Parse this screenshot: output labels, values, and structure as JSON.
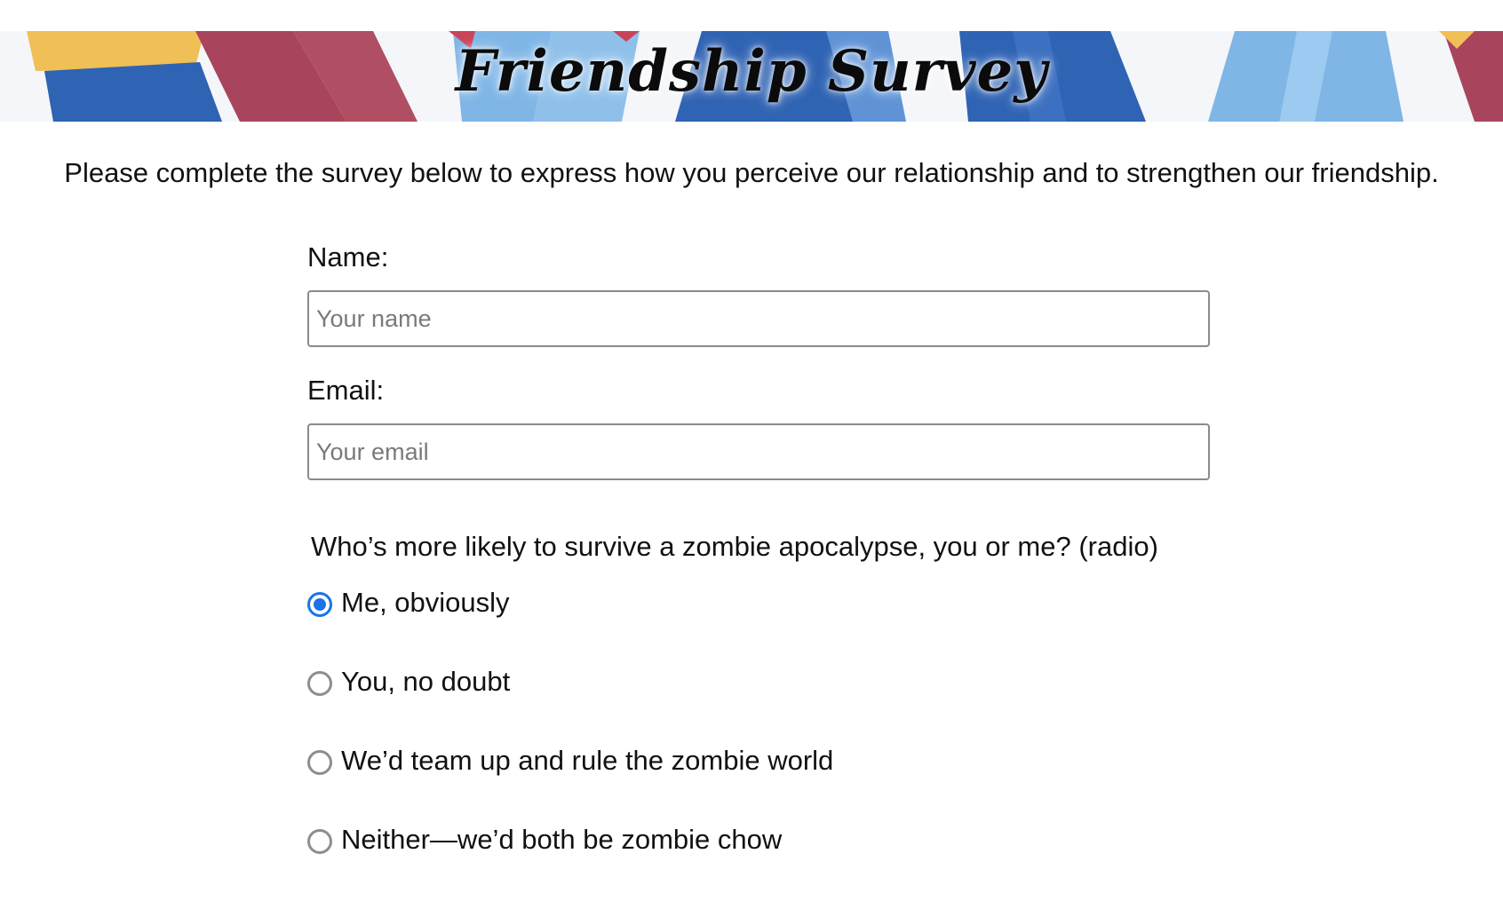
{
  "banner": {
    "title": "Friendship Survey"
  },
  "intro_text": "Please complete the survey below to express how you perceive our relationship and to strengthen our friendship.",
  "form": {
    "name": {
      "label": "Name:",
      "placeholder": "Your name",
      "value": ""
    },
    "email": {
      "label": "Email:",
      "placeholder": "Your email",
      "value": ""
    },
    "question": {
      "text": "Who’s more likely to survive a zombie apocalypse, you or me? (radio)",
      "options": [
        {
          "label": "Me, obviously",
          "checked": true
        },
        {
          "label": "You, no doubt",
          "checked": false
        },
        {
          "label": "We’d team up and rule the zombie world",
          "checked": false
        },
        {
          "label": "Neither—we’d both be zombie chow",
          "checked": false
        }
      ]
    }
  },
  "colors": {
    "radio_selected": "#1a73e8",
    "radio_unselected": "#8d8d93",
    "input_border": "#8a8a8f",
    "banner_dark_blue": "#2f63b3",
    "banner_light_blue": "#7fb6e6",
    "banner_crimson": "#a8455c",
    "banner_yellow": "#f0bf55"
  }
}
